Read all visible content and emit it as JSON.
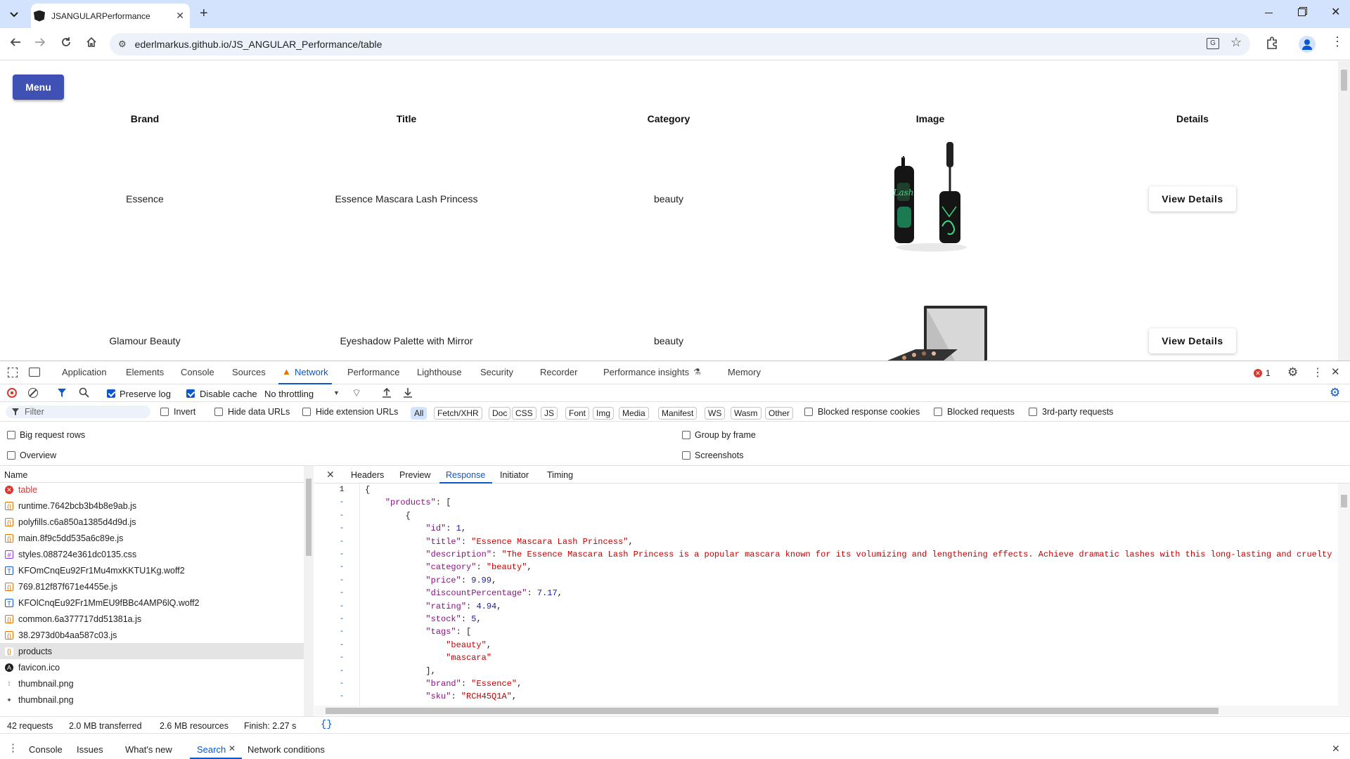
{
  "browser": {
    "tab_title": "JSANGULARPerformance",
    "url": "ederlmarkus.github.io/JS_ANGULAR_Performance/table"
  },
  "page": {
    "menu_label": "Menu",
    "headers": [
      "Brand",
      "Title",
      "Category",
      "Image",
      "Details"
    ],
    "rows": [
      {
        "brand": "Essence",
        "title": "Essence Mascara Lash Princess",
        "category": "beauty",
        "details": "View Details"
      },
      {
        "brand": "Glamour Beauty",
        "title": "Eyeshadow Palette with Mirror",
        "category": "beauty",
        "details": "View Details"
      }
    ]
  },
  "devtools": {
    "tabs": [
      "Application",
      "Elements",
      "Console",
      "Sources",
      "Network",
      "Performance",
      "Lighthouse",
      "Security",
      "Recorder",
      "Performance insights",
      "Memory"
    ],
    "error_count": "1",
    "toolbar": {
      "preserve_log": "Preserve log",
      "disable_cache": "Disable cache",
      "throttling": "No throttling"
    },
    "filter": {
      "placeholder": "Filter",
      "invert": "Invert",
      "hide_data_urls": "Hide data URLs",
      "hide_extension_urls": "Hide extension URLs",
      "types": [
        "All",
        "Fetch/XHR",
        "Doc",
        "CSS",
        "JS",
        "Font",
        "Img",
        "Media",
        "Manifest",
        "WS",
        "Wasm",
        "Other"
      ],
      "blocked_cookies": "Blocked response cookies",
      "blocked_requests": "Blocked requests",
      "third_party": "3rd-party requests"
    },
    "options": {
      "big_rows": "Big request rows",
      "overview": "Overview",
      "group_by_frame": "Group by frame",
      "screenshots": "Screenshots"
    },
    "name_header": "Name",
    "requests": [
      {
        "name": "table",
        "type": "error"
      },
      {
        "name": "runtime.7642bcb3b4b8e9ab.js",
        "type": "js"
      },
      {
        "name": "polyfills.c6a850a1385d4d9d.js",
        "type": "js"
      },
      {
        "name": "main.8f9c5dd535a6c89e.js",
        "type": "js"
      },
      {
        "name": "styles.088724e361dc0135.css",
        "type": "css"
      },
      {
        "name": "KFOmCnqEu92Fr1Mu4mxKKTU1Kg.woff2",
        "type": "font"
      },
      {
        "name": "769.812f87f671e4455e.js",
        "type": "js"
      },
      {
        "name": "KFOlCnqEu92Fr1MmEU9fBBc4AMP6lQ.woff2",
        "type": "font"
      },
      {
        "name": "common.6a377717dd51381a.js",
        "type": "js"
      },
      {
        "name": "38.2973d0b4aa587c03.js",
        "type": "js"
      },
      {
        "name": "products",
        "type": "xhr"
      },
      {
        "name": "favicon.ico",
        "type": "ico"
      },
      {
        "name": "thumbnail.png",
        "type": "img"
      },
      {
        "name": "thumbnail.png",
        "type": "img2"
      }
    ],
    "detail_tabs": [
      "Headers",
      "Preview",
      "Response",
      "Initiator",
      "Timing"
    ],
    "response_lines": [
      {
        "t": "{"
      },
      {
        "t": "    \"products\": ["
      },
      {
        "t": "        {"
      },
      {
        "t": "            \"id\": 1,"
      },
      {
        "t": "            \"title\": \"Essence Mascara Lash Princess\","
      },
      {
        "t": "            \"description\": \"The Essence Mascara Lash Princess is a popular mascara known for its volumizing and lengthening effects. Achieve dramatic lashes with this long-lasting and cruelty"
      },
      {
        "t": "            \"category\": \"beauty\","
      },
      {
        "t": "            \"price\": 9.99,"
      },
      {
        "t": "            \"discountPercentage\": 7.17,"
      },
      {
        "t": "            \"rating\": 4.94,"
      },
      {
        "t": "            \"stock\": 5,"
      },
      {
        "t": "            \"tags\": ["
      },
      {
        "t": "                \"beauty\","
      },
      {
        "t": "                \"mascara\""
      },
      {
        "t": "            ],"
      },
      {
        "t": "            \"brand\": \"Essence\","
      },
      {
        "t": "            \"sku\": \"RCH45Q1A\","
      }
    ],
    "status": {
      "requests": "42 requests",
      "transferred": "2.0 MB transferred",
      "resources": "2.6 MB resources",
      "finish": "Finish: 2.27 s"
    },
    "drawer_tabs": [
      "Console",
      "Issues",
      "What's new",
      "Search",
      "Network conditions"
    ]
  }
}
